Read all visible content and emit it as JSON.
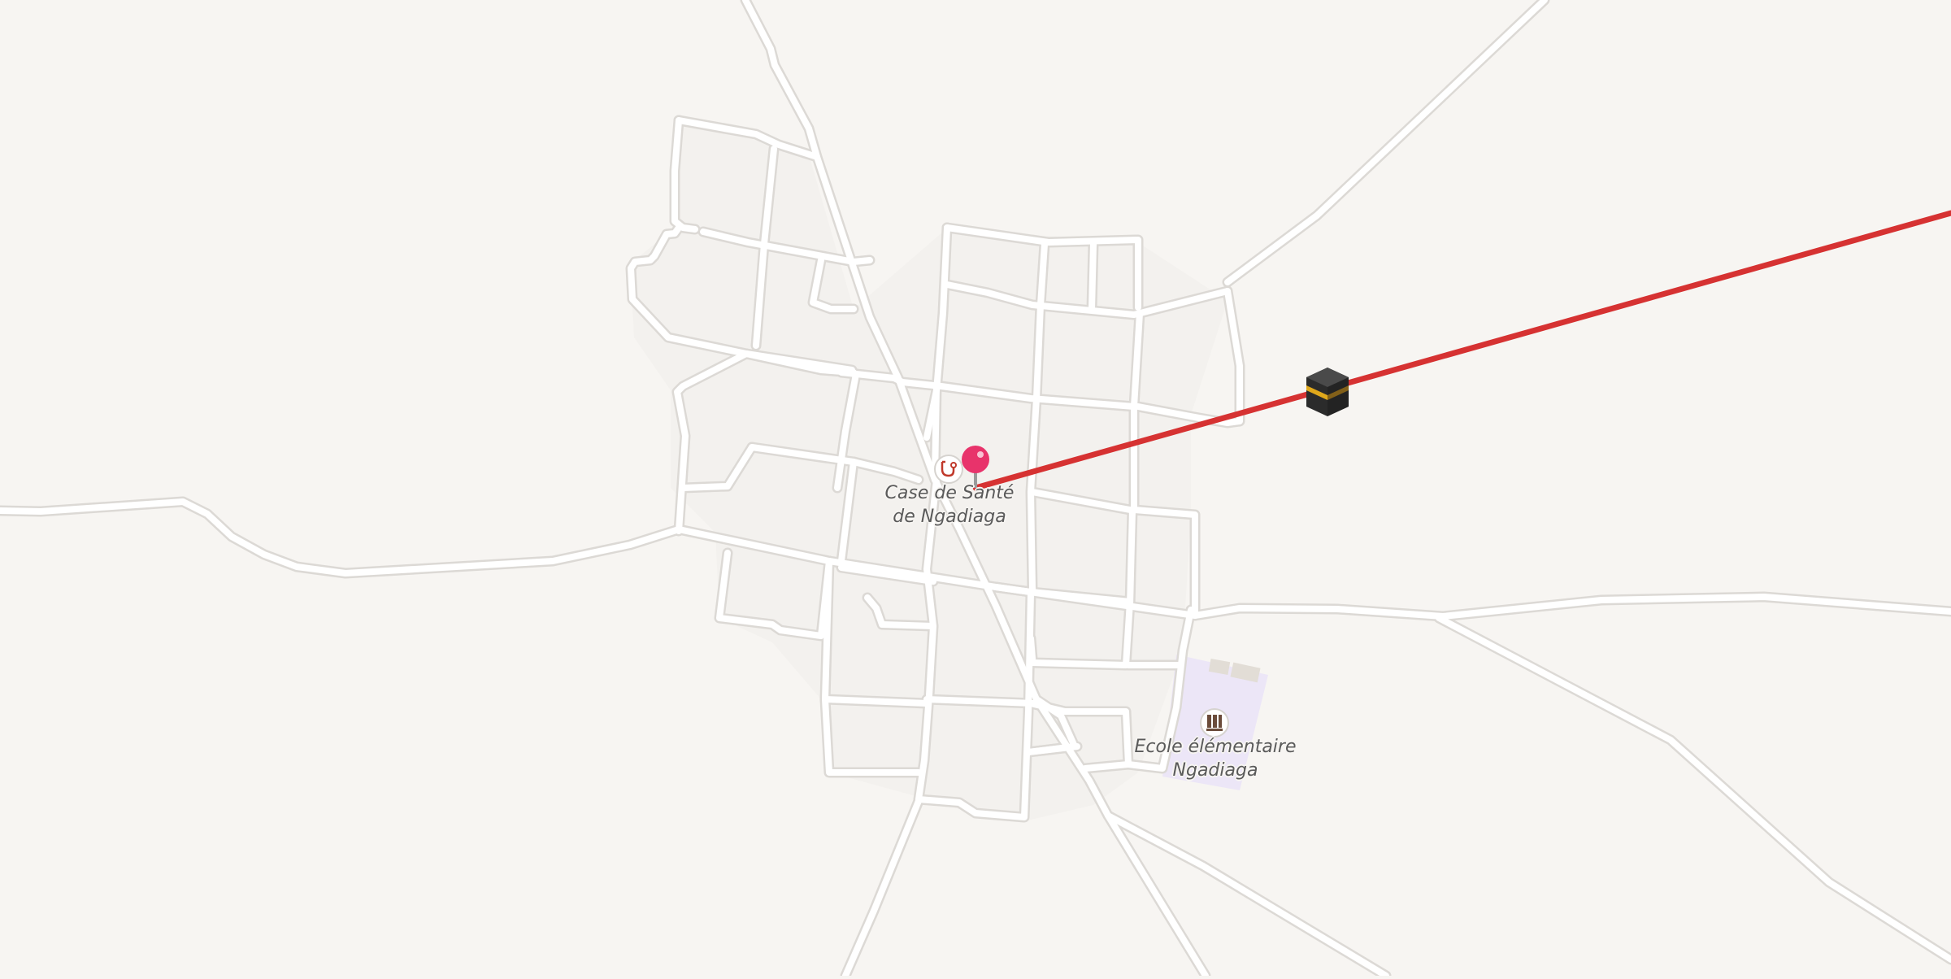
{
  "map": {
    "pois": [
      {
        "id": "health",
        "name_line1": "Case de Santé",
        "name_line2": "de Ngadiaga",
        "icon": "stethoscope-icon"
      },
      {
        "id": "school",
        "name_line1": "Ecole élémentaire",
        "name_line2": "Ngadiaga",
        "icon": "school-icon"
      }
    ],
    "pin": {
      "icon": "map-pin-icon",
      "color": "#e8336b"
    },
    "qibla": {
      "icon": "kaaba-icon",
      "line_color": "#d63232"
    },
    "colors": {
      "background": "#f7f5f2",
      "road_casing": "#d9d6d2",
      "road_fill": "#ffffff",
      "block_fill": "#f3f1ee",
      "school_area": "#ece6f7",
      "label_text": "#5a5a5a"
    }
  }
}
